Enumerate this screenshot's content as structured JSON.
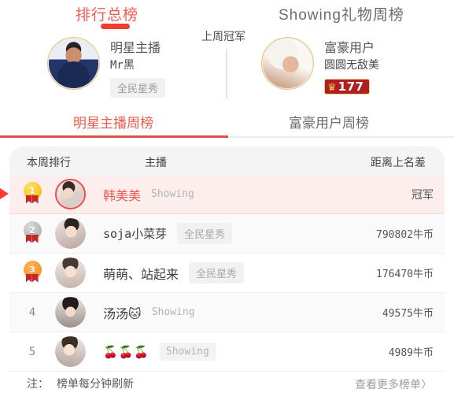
{
  "header": {
    "left_panel_title": "排行总榜",
    "right_panel_title": "Showing礼物周榜",
    "last_week_champion_label": "上周冠军",
    "champions": [
      {
        "role": "明星主播",
        "name": "Mr黑",
        "tag": "全民星秀",
        "avatar": "man-avatar"
      },
      {
        "role": "富豪用户",
        "name": "圆圆无敌美",
        "crown_icon": "crown-icon",
        "crown_value": "177",
        "avatar": "sleeping-girl-avatar"
      }
    ]
  },
  "tabs": [
    {
      "label": "明星主播周榜",
      "active": true
    },
    {
      "label": "富豪用户周榜",
      "active": false
    }
  ],
  "table": {
    "columns": [
      "本周排行",
      "主播",
      "距离上名差"
    ],
    "rows": [
      {
        "rank": "1",
        "rank_badge": "gold-medal-icon",
        "name": "韩美美",
        "status": "Showing",
        "status_style": "plain",
        "score": "冠军",
        "highlighted": true,
        "current_marker": "play-arrow-icon",
        "avatar": "girl1-avatar"
      },
      {
        "rank": "2",
        "rank_badge": "silver-medal-icon",
        "name": "soja小菜芽",
        "status": "全民星秀",
        "status_style": "tag",
        "score": "790802牛币",
        "highlighted": false,
        "avatar": "girl2-avatar"
      },
      {
        "rank": "3",
        "rank_badge": "bronze-medal-icon",
        "name": "萌萌、站起来",
        "status": "全民星秀",
        "status_style": "tag",
        "score": "176470牛币",
        "highlighted": false,
        "avatar": "girl3-avatar"
      },
      {
        "rank": "4",
        "rank_badge": "",
        "name": "汤汤🐱",
        "status": "Showing",
        "status_style": "plain",
        "score": "49575牛币",
        "highlighted": false,
        "avatar": "girl4-avatar"
      },
      {
        "rank": "5",
        "rank_badge": "",
        "name": "🍒🍒🍒",
        "status": "Showing",
        "status_style": "boxed",
        "score": "4989牛币",
        "highlighted": false,
        "avatar": "girl5-avatar"
      }
    ]
  },
  "footer": {
    "note_label": "注：",
    "note_text": "榜单每分钟刷新",
    "more_link": "查看更多榜单〉"
  },
  "colors": {
    "accent_red": "#f13c32",
    "tab_active": "#ec5b51",
    "highlight_row": "#fdeeee",
    "crown_badge": "#ad1f21",
    "gold": "#f5b300",
    "silver": "#a8a8a8",
    "bronze": "#ef8a12"
  }
}
